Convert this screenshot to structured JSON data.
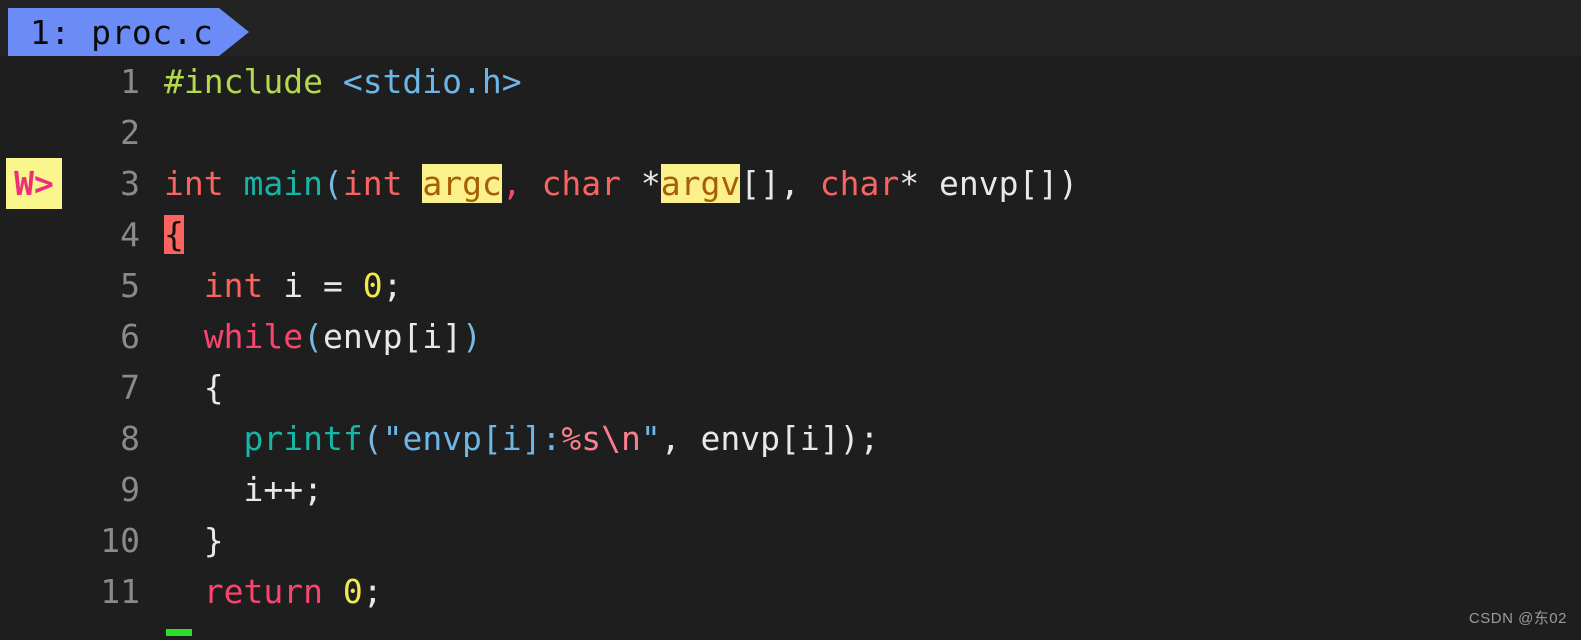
{
  "editor": {
    "background_color": "#1e1e1e",
    "tabbar": {
      "tabs": [
        {
          "label": "1: proc.c",
          "active": true,
          "color": "#6b8cf7"
        }
      ]
    },
    "gutter": {
      "sign_marker": {
        "text": "W>",
        "line": 3,
        "background_color": "#fbf58e",
        "foreground_color": "#ef2d7a"
      }
    },
    "filename": "proc.c",
    "language": "c",
    "lines": [
      {
        "number": "1",
        "tokens": [
          {
            "text": "#include",
            "style": "t-pre"
          },
          {
            "text": " ",
            "style": "t-plain"
          },
          {
            "text": "<stdio.h>",
            "style": "t-header"
          }
        ]
      },
      {
        "number": "2",
        "tokens": []
      },
      {
        "number": "3",
        "tokens": [
          {
            "text": "int",
            "style": "t-type"
          },
          {
            "text": " ",
            "style": "t-plain"
          },
          {
            "text": "main",
            "style": "t-func"
          },
          {
            "text": "(",
            "style": "t-paren"
          },
          {
            "text": "int",
            "style": "t-type"
          },
          {
            "text": " ",
            "style": "t-plain"
          },
          {
            "text": "argc",
            "style": "t-hl"
          },
          {
            "text": ",",
            "style": "t-kw"
          },
          {
            "text": " ",
            "style": "t-plain"
          },
          {
            "text": "char",
            "style": "t-type"
          },
          {
            "text": " ",
            "style": "t-plain"
          },
          {
            "text": "*",
            "style": "t-plain"
          },
          {
            "text": "argv",
            "style": "t-hl"
          },
          {
            "text": "[], ",
            "style": "t-plain"
          },
          {
            "text": "char",
            "style": "t-type"
          },
          {
            "text": "* ",
            "style": "t-plain"
          },
          {
            "text": "envp",
            "style": "t-plain"
          },
          {
            "text": "[])",
            "style": "t-plain"
          }
        ]
      },
      {
        "number": "4",
        "tokens": [
          {
            "text": "{",
            "style": "t-brkt"
          }
        ]
      },
      {
        "number": "5",
        "tokens": [
          {
            "text": "  ",
            "style": "t-plain"
          },
          {
            "text": "int",
            "style": "t-type"
          },
          {
            "text": " i = ",
            "style": "t-plain"
          },
          {
            "text": "0",
            "style": "t-num"
          },
          {
            "text": ";",
            "style": "t-plain"
          }
        ]
      },
      {
        "number": "6",
        "tokens": [
          {
            "text": "  ",
            "style": "t-plain"
          },
          {
            "text": "while",
            "style": "t-kw"
          },
          {
            "text": "(",
            "style": "t-paren"
          },
          {
            "text": "envp[i]",
            "style": "t-plain"
          },
          {
            "text": ")",
            "style": "t-paren"
          }
        ]
      },
      {
        "number": "7",
        "tokens": [
          {
            "text": "  {",
            "style": "t-plain"
          }
        ]
      },
      {
        "number": "8",
        "tokens": [
          {
            "text": "    ",
            "style": "t-plain"
          },
          {
            "text": "printf",
            "style": "t-func"
          },
          {
            "text": "(",
            "style": "t-paren"
          },
          {
            "text": "\"envp[i]:",
            "style": "t-str"
          },
          {
            "text": "%s",
            "style": "t-esc"
          },
          {
            "text": "\\n",
            "style": "t-esc"
          },
          {
            "text": "\"",
            "style": "t-str"
          },
          {
            "text": ", envp[i]);",
            "style": "t-plain"
          }
        ]
      },
      {
        "number": "9",
        "tokens": [
          {
            "text": "    i++;",
            "style": "t-plain"
          }
        ]
      },
      {
        "number": "10",
        "tokens": [
          {
            "text": "  }",
            "style": "t-plain"
          }
        ]
      },
      {
        "number": "11",
        "tokens": [
          {
            "text": "  ",
            "style": "t-plain"
          },
          {
            "text": "return",
            "style": "t-kw"
          },
          {
            "text": " ",
            "style": "t-plain"
          },
          {
            "text": "0",
            "style": "t-num"
          },
          {
            "text": ";",
            "style": "t-plain"
          }
        ]
      }
    ],
    "cursor": {
      "color": "#2ae02a",
      "line": 12
    }
  },
  "watermark": {
    "text": "CSDN @东02"
  }
}
